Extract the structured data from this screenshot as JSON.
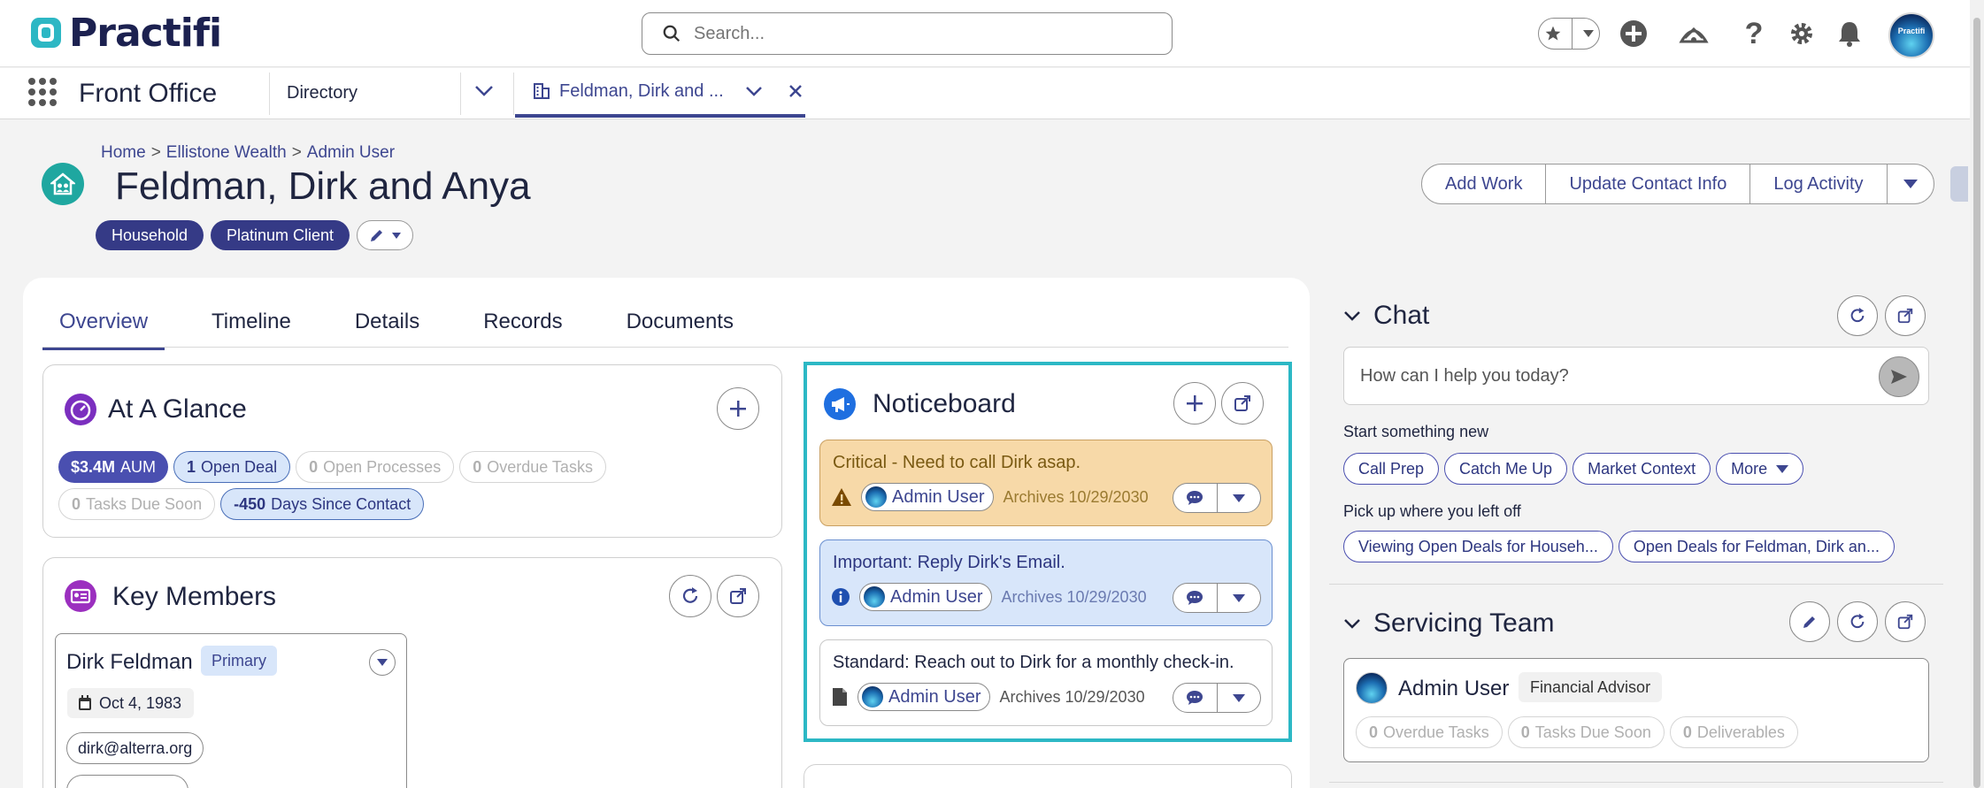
{
  "topbar": {
    "brand": "Practifi",
    "search_placeholder": "Search..."
  },
  "avatar_text": "Practifi",
  "nav": {
    "app_name": "Front Office",
    "directory": "Directory",
    "record_tab": "Feldman, Dirk and ..."
  },
  "breadcrumb": {
    "home": "Home",
    "firm": "Ellistone Wealth",
    "user": "Admin User"
  },
  "record": {
    "title": "Feldman, Dirk and Anya",
    "tags": [
      "Household",
      "Platinum Client"
    ]
  },
  "actions": {
    "add_work": "Add Work",
    "update_contact": "Update Contact Info",
    "log_activity": "Log Activity"
  },
  "tabs": [
    "Overview",
    "Timeline",
    "Details",
    "Records",
    "Documents"
  ],
  "glance": {
    "title": "At A Glance",
    "aum_value": "$3.4M",
    "aum_label": "AUM",
    "open_deal_count": "1",
    "open_deal_label": "Open Deal",
    "open_processes_count": "0",
    "open_processes_label": "Open Processes",
    "overdue_tasks_count": "0",
    "overdue_tasks_label": "Overdue Tasks",
    "tasks_due_count": "0",
    "tasks_due_label": "Tasks Due Soon",
    "days_since_count": "-450",
    "days_since_label": "Days Since Contact"
  },
  "key_members": {
    "title": "Key Members",
    "member_name": "Dirk Feldman",
    "member_role": "Primary",
    "birthday": "Oct 4, 1983",
    "email": "dirk@alterra.org"
  },
  "noticeboard": {
    "title": "Noticeboard",
    "notes": [
      {
        "text": "Critical - Need to call Dirk asap.",
        "user": "Admin User",
        "archive": "Archives 10/29/2030"
      },
      {
        "text": "Important: Reply Dirk's Email.",
        "user": "Admin User",
        "archive": "Archives 10/29/2030"
      },
      {
        "text": "Standard: Reach out to Dirk for a monthly check-in.",
        "user": "Admin User",
        "archive": "Archives 10/29/2030"
      }
    ]
  },
  "chat": {
    "title": "Chat",
    "placeholder": "How can I help you today?",
    "start_label": "Start something new",
    "chips": [
      "Call Prep",
      "Catch Me Up",
      "Market Context",
      "More"
    ],
    "pickup_label": "Pick up where you left off",
    "recent": [
      "Viewing Open Deals for Househ...",
      "Open Deals for Feldman, Dirk an..."
    ]
  },
  "servicing_team": {
    "title": "Servicing Team",
    "member": "Admin User",
    "role": "Financial Advisor",
    "stats": [
      {
        "count": "0",
        "label": "Overdue Tasks"
      },
      {
        "count": "0",
        "label": "Tasks Due Soon"
      },
      {
        "count": "0",
        "label": "Deliverables"
      }
    ]
  },
  "colors": {
    "accent": "#3d4690",
    "teal": "#2cb8c5",
    "critical_bg": "#f7d9a8",
    "important_bg": "#d8e6fa"
  }
}
